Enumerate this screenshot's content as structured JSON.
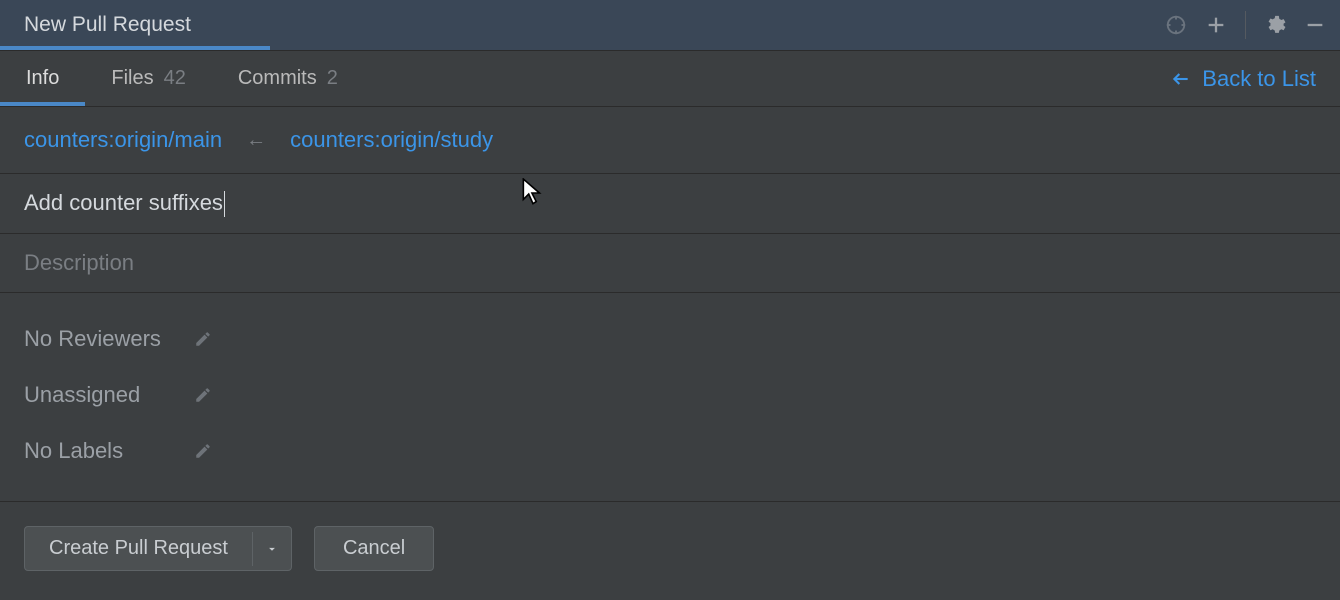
{
  "header": {
    "title": "New Pull Request"
  },
  "tabs": [
    {
      "label": "Info",
      "count": null,
      "active": true
    },
    {
      "label": "Files",
      "count": "42",
      "active": false
    },
    {
      "label": "Commits",
      "count": "2",
      "active": false
    }
  ],
  "back_link": "Back to List",
  "branches": {
    "base": "counters:origin/main",
    "head": "counters:origin/study"
  },
  "title_field": {
    "value": "Add counter suffixes"
  },
  "description": {
    "placeholder": "Description"
  },
  "meta": {
    "reviewers": "No Reviewers",
    "assignee": "Unassigned",
    "labels": "No Labels"
  },
  "buttons": {
    "create": "Create Pull Request",
    "cancel": "Cancel"
  }
}
